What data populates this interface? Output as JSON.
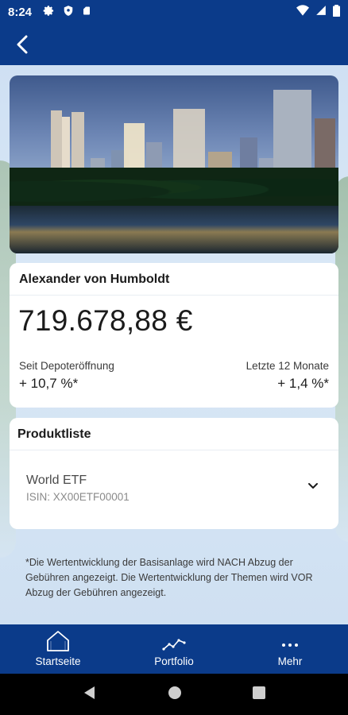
{
  "status_bar": {
    "time": "8:24",
    "icons": [
      "gear-icon",
      "shield-icon",
      "sd-card-icon",
      "wifi-icon",
      "signal-icon",
      "battery-icon"
    ]
  },
  "app_bar": {
    "back_icon": "chevron-left-icon"
  },
  "hero": {
    "image_description": "city-skyline-at-night"
  },
  "account": {
    "name": "Alexander von Humboldt",
    "amount": "719.678,88 €",
    "since_opening_label": "Seit Depoteröffnung",
    "since_opening_value": "+ 10,7 %*",
    "last_12_months_label": "Letzte 12 Monate",
    "last_12_months_value": "+ 1,4 %*"
  },
  "products": {
    "title": "Produktliste",
    "items": [
      {
        "name": "World ETF",
        "isin": "ISIN: XX00ETF00001"
      }
    ]
  },
  "footnote": "*Die Wertentwicklung der Basisanlage wird NACH Abzug der Gebühren angezeigt. Die Wertentwicklung der Themen wird VOR Abzug der Gebühren angezeigt.",
  "bottom_nav": {
    "items": [
      {
        "label": "Startseite",
        "icon": "home-icon"
      },
      {
        "label": "Portfolio",
        "icon": "chart-line-icon"
      },
      {
        "label": "Mehr",
        "icon": "more-dots-icon"
      }
    ]
  },
  "colors": {
    "primary": "#0b3b8a",
    "background": "#d5e5f5",
    "card": "#ffffff"
  }
}
